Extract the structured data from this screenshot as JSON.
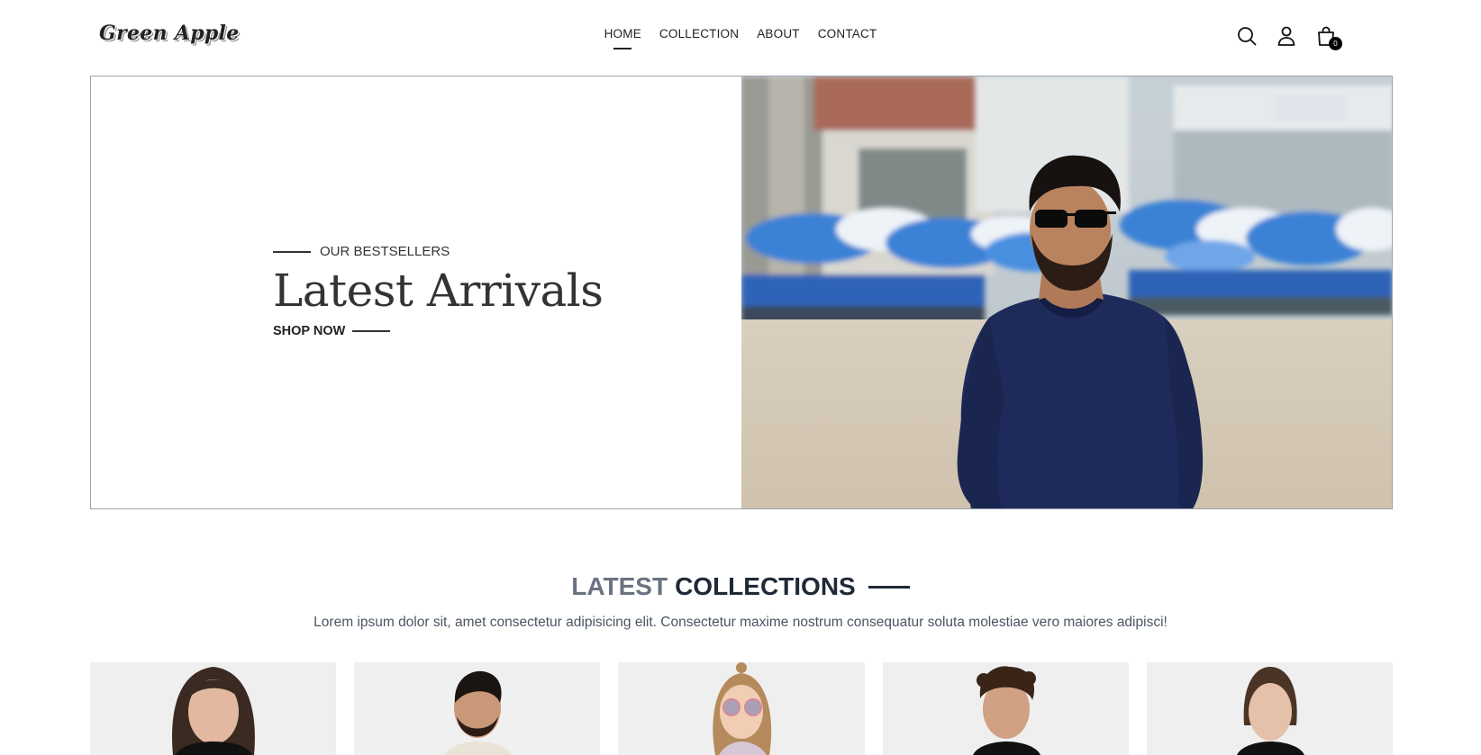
{
  "brand": {
    "logo_text": "Green Apple"
  },
  "nav": {
    "items": [
      {
        "label": "HOME",
        "active": true
      },
      {
        "label": "COLLECTION",
        "active": false
      },
      {
        "label": "ABOUT",
        "active": false
      },
      {
        "label": "CONTACT",
        "active": false
      }
    ]
  },
  "header": {
    "icons": [
      "search-icon",
      "user-icon",
      "shopping-bag-icon"
    ],
    "cart_count": "0"
  },
  "hero": {
    "eyebrow": "OUR BESTSELLERS",
    "title": "Latest Arrivals",
    "cta": "SHOP NOW"
  },
  "collections": {
    "heading_light": "LATEST",
    "heading_bold": "COLLECTIONS",
    "description": "Lorem ipsum dolor sit, amet consectetur adipisicing elit. Consectetur maxime nostrum consequatur soluta molestiae vero maiores adipisci!"
  },
  "colors": {
    "text_dark": "#1f2937",
    "text_muted": "#6b7280",
    "border": "#9ca3af",
    "shirt_navy": "#1e2a5a",
    "umbrella_blue": "#3b82d6"
  }
}
